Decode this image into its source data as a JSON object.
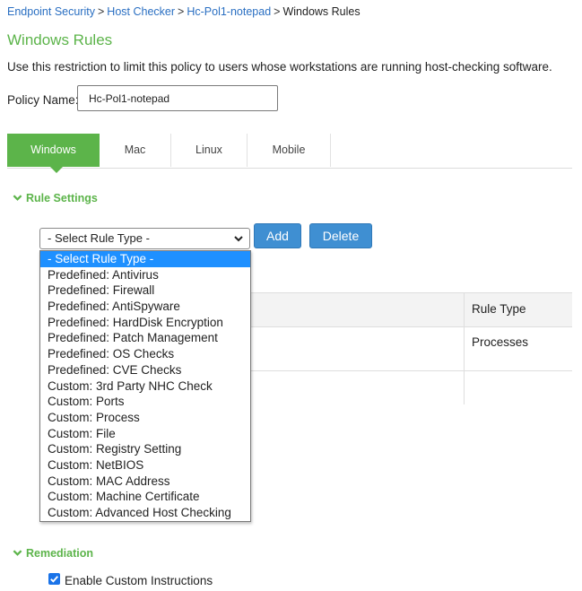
{
  "breadcrumb": {
    "item1": "Endpoint Security",
    "item2": "Host Checker",
    "item3": "Hc-Pol1-notepad",
    "current": "Windows Rules",
    "separator": ">"
  },
  "page": {
    "title": "Windows Rules",
    "description": "Use this restriction to limit this policy to users whose workstations are running host-checking software."
  },
  "policy": {
    "label": "Policy Name:",
    "value": "Hc-Pol1-notepad"
  },
  "tabs": [
    {
      "label": "Windows",
      "active": true
    },
    {
      "label": "Mac"
    },
    {
      "label": "Linux"
    },
    {
      "label": "Mobile"
    }
  ],
  "rule_settings": {
    "heading": "Rule Settings",
    "select_value": "- Select Rule Type -",
    "add_label": "Add",
    "delete_label": "Delete",
    "options": [
      "- Select Rule Type -",
      "Predefined: Antivirus",
      "Predefined: Firewall",
      "Predefined: AntiSpyware",
      "Predefined: HardDisk Encryption",
      "Predefined: Patch Management",
      "Predefined: OS Checks",
      "Predefined: CVE Checks",
      "Custom: 3rd Party NHC Check",
      "Custom: Ports",
      "Custom: Process",
      "Custom: File",
      "Custom: Registry Setting",
      "Custom: NetBIOS",
      "Custom: MAC Address",
      "Custom: Machine Certificate",
      "Custom: Advanced Host Checking"
    ]
  },
  "table": {
    "header_rule_type": "Rule Type",
    "row1_rule_type": "Processes"
  },
  "remediation": {
    "heading": "Remediation",
    "checkbox_label": "Enable Custom Instructions",
    "checked": true
  },
  "colors": {
    "accent_green": "#5cb44a",
    "button_blue": "#3f8fd2",
    "link_blue": "#2a6fc2",
    "highlight_blue": "#1e90ff"
  }
}
